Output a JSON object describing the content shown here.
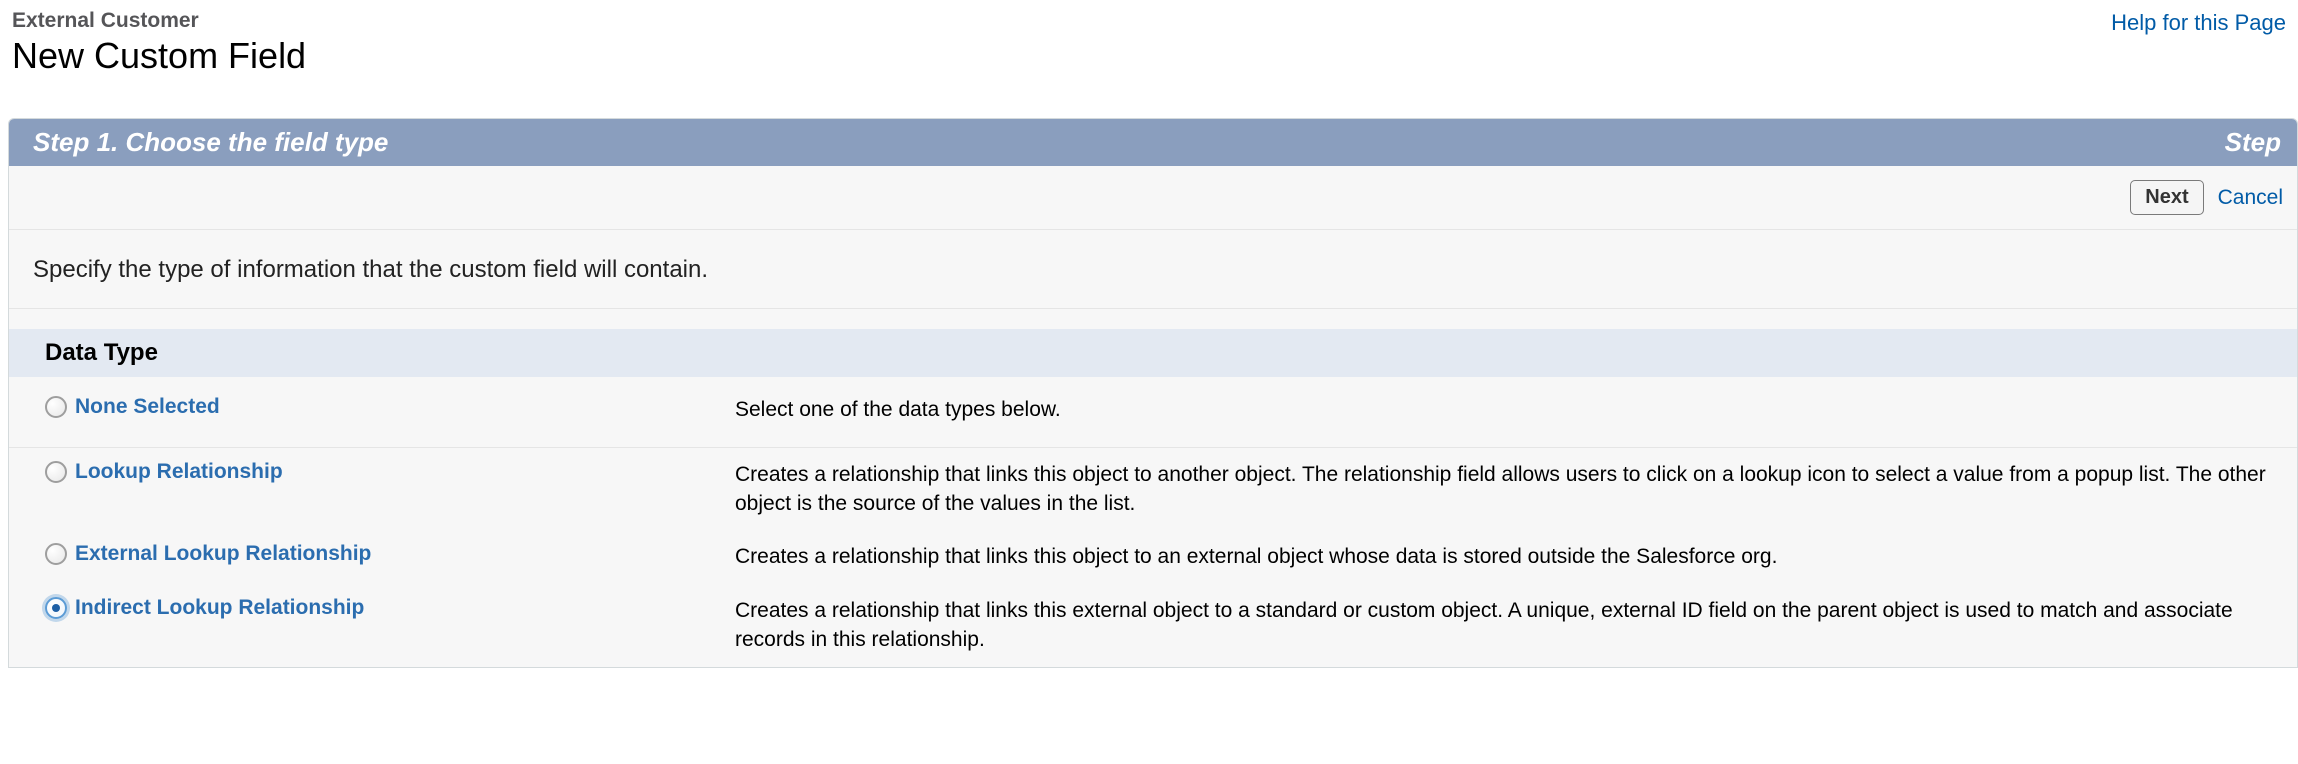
{
  "header": {
    "breadcrumb": "External Customer",
    "title": "New Custom Field",
    "help_link": "Help for this Page"
  },
  "wizard": {
    "step_title": "Step 1. Choose the field type",
    "step_indicator": "Step",
    "next_label": "Next",
    "cancel_label": "Cancel",
    "instruction": "Specify the type of information that the custom field will contain.",
    "section_title": "Data Type"
  },
  "data_types": [
    {
      "label": "None Selected",
      "description": "Select one of the data types below.",
      "selected": false
    },
    {
      "label": "Lookup Relationship",
      "description": "Creates a relationship that links this object to another object. The relationship field allows users to click on a lookup icon to select a value from a popup list. The other object is the source of the values in the list.",
      "selected": false
    },
    {
      "label": "External Lookup Relationship",
      "description": "Creates a relationship that links this object to an external object whose data is stored outside the Salesforce org.",
      "selected": false
    },
    {
      "label": "Indirect Lookup Relationship",
      "description": "Creates a relationship that links this external object to a standard or custom object. A unique, external ID field on the parent object is used to match and associate records in this relationship.",
      "selected": true
    }
  ]
}
